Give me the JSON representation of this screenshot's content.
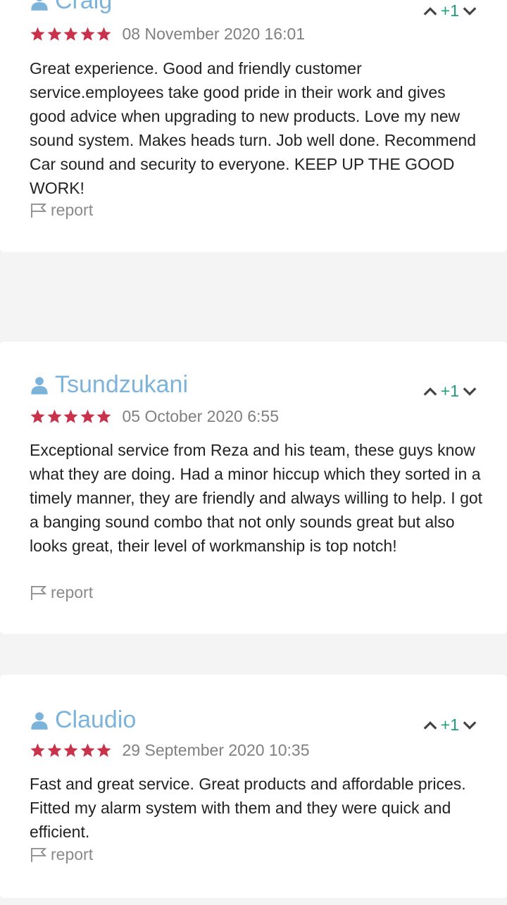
{
  "colors": {
    "author": "#7bb3db",
    "star": "#c8324a",
    "vote": "#1e9e7a",
    "date": "#808080",
    "body": "#222222",
    "report": "#8a8a8a",
    "page_bg": "#f4f4f4",
    "card_bg": "#ffffff"
  },
  "icons": {
    "author": "user-icon",
    "rating": "star-icon",
    "vote_up": "chevron-up-icon",
    "vote_down": "chevron-down-icon",
    "report": "flag-icon"
  },
  "reviews": [
    {
      "author": "Craig",
      "rating": 5,
      "date": "08 November 2020 16:01",
      "votes": "+1",
      "text": "Great experience. Good and friendly customer service.employees take good pride in their work and gives good advice when upgrading to new products. Love my new sound system. Makes heads turn. Job well done. Recommend Car sound and security to everyone. KEEP UP THE GOOD WORK!",
      "report_label": "report"
    },
    {
      "author": "Tsundzukani",
      "rating": 5,
      "date": "05 October 2020 6:55",
      "votes": "+1",
      "text": "Exceptional service from Reza and his team, these guys know what they are doing. Had a minor hiccup which they sorted in a timely manner, they are friendly and always willing to help. I got a banging sound combo that not only sounds great but also looks great, their level of workmanship is top notch!",
      "report_label": "report"
    },
    {
      "author": "Claudio",
      "rating": 5,
      "date": "29 September 2020 10:35",
      "votes": "+1",
      "text": "Fast and great service. Great products and affordable prices. Fitted my alarm system with them and they were quick and efficient.",
      "report_label": "report"
    }
  ]
}
